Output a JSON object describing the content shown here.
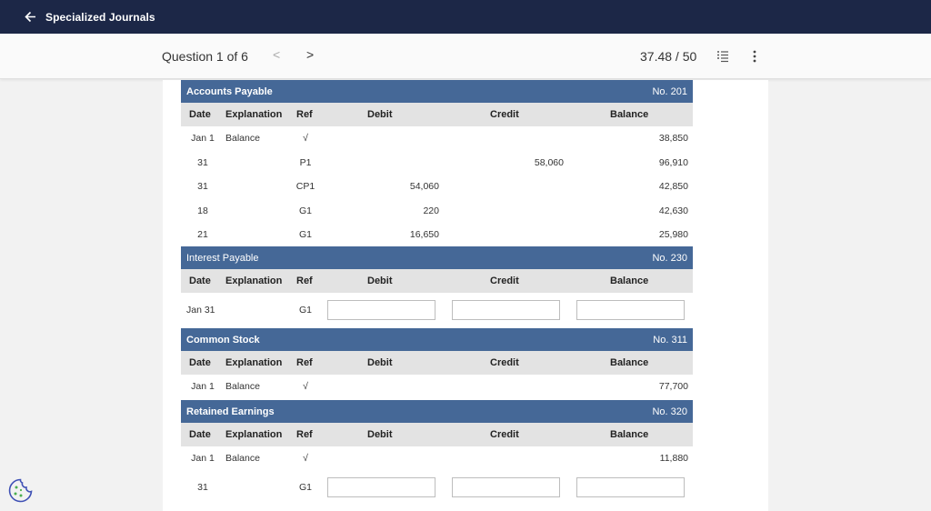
{
  "app": {
    "title": "Specialized Journals"
  },
  "question": {
    "label": "Question 1 of 6",
    "prev": "<",
    "next": ">",
    "score": "37.48 / 50"
  },
  "columns": {
    "date": "Date",
    "explanation": "Explanation",
    "ref": "Ref",
    "debit": "Debit",
    "credit": "Credit",
    "balance": "Balance"
  },
  "ledgers": [
    {
      "name": "Accounts Payable",
      "no": "No. 201",
      "rows": [
        {
          "date": "Jan 1",
          "explanation": "Balance",
          "ref": "√",
          "debit": "",
          "credit": "",
          "balance": "38,850"
        },
        {
          "date": "31",
          "explanation": "",
          "ref": "P1",
          "debit": "",
          "credit": "58,060",
          "balance": "96,910"
        },
        {
          "date": "31",
          "explanation": "",
          "ref": "CP1",
          "debit": "54,060",
          "credit": "",
          "balance": "42,850"
        },
        {
          "date": "18",
          "explanation": "",
          "ref": "G1",
          "debit": "220",
          "credit": "",
          "balance": "42,630"
        },
        {
          "date": "21",
          "explanation": "",
          "ref": "G1",
          "debit": "16,650",
          "credit": "",
          "balance": "25,980"
        }
      ]
    },
    {
      "name": "Interest Payable",
      "no": "No. 230",
      "rows": [
        {
          "date": "Jan 31",
          "explanation": "",
          "ref": "G1",
          "debit_value": "",
          "credit_value": "",
          "balance_value": ""
        }
      ]
    },
    {
      "name": "Common Stock",
      "no": "No. 311",
      "rows": [
        {
          "date": "Jan 1",
          "explanation": "Balance",
          "ref": "√",
          "debit": "",
          "credit": "",
          "balance": "77,700"
        }
      ]
    },
    {
      "name": "Retained Earnings",
      "no": "No. 320",
      "rows": [
        {
          "date": "Jan 1",
          "explanation": "Balance",
          "ref": "√",
          "debit": "",
          "credit": "",
          "balance": "11,880"
        },
        {
          "date": "31",
          "explanation": "",
          "ref": "G1",
          "debit_value": "",
          "credit_value": "",
          "balance_value": ""
        }
      ]
    }
  ],
  "icons": {
    "back": "arrow-left-icon",
    "list": "list-icon",
    "more": "more-vertical-icon",
    "cookie": "cookie-icon"
  },
  "colors": {
    "topbar": "#1c2747",
    "ledger_header": "#456897",
    "column_header": "#e3e3e3",
    "cookie": "#3f51b5"
  }
}
